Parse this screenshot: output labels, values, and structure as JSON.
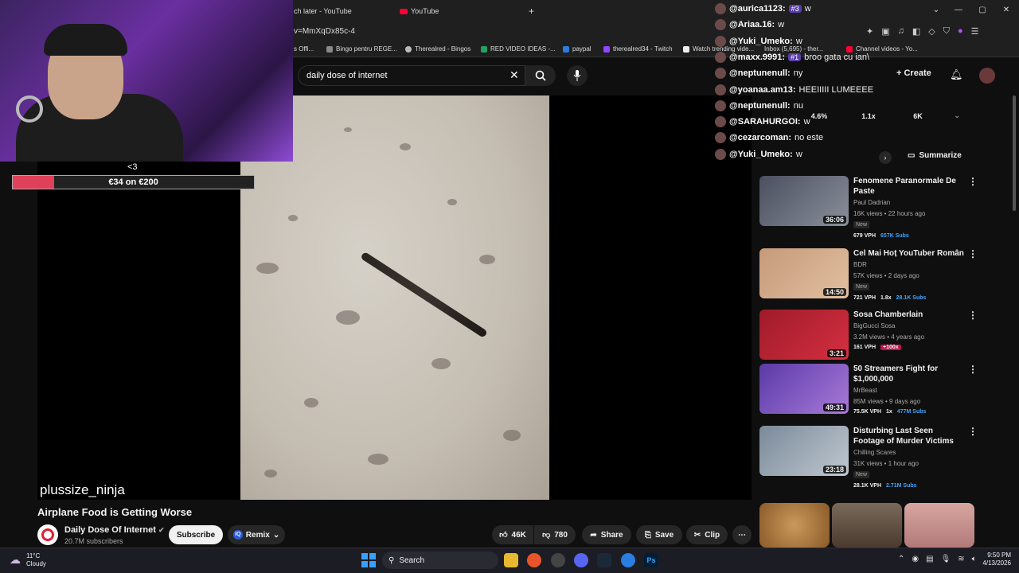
{
  "browser": {
    "tabs": [
      {
        "label": "ch later - YouTube"
      },
      {
        "label": "YouTube"
      }
    ],
    "new_tab": "+",
    "url": "v=MmXqDx85c-4",
    "bookmarks": [
      "s Offi...",
      "Bingo pentru REGE...",
      "Therealred - Bingos",
      "RED VIDEO IDEAS -...",
      "paypal",
      "therealred34 - Twitch",
      "Watch trending vide...",
      "Inbox (5,695) - ther...",
      "Channel videos - Yo..."
    ]
  },
  "youtube": {
    "search_value": "daily dose of internet",
    "create_label": "Create",
    "video_title": "Airplane Food is Getting Worse",
    "channel_name": "Daily Dose Of Internet",
    "channel_subs": "20.7M subscribers",
    "subscribe_label": "Subscribe",
    "remix_label": "Remix",
    "likes": "46K",
    "dislikes": "780",
    "share_label": "Share",
    "save_label": "Save",
    "clip_label": "Clip",
    "more_label": "⋯",
    "overlay_stats": [
      "4.6%",
      "1.1x",
      "6K"
    ],
    "summarize_label": "Summarize",
    "recommendations": [
      {
        "title": "Fenomene Paranormale De Paste",
        "channel": "Paul Dadrian",
        "meta": "16K views • 22 hours ago",
        "new": "New",
        "duration": "36:06",
        "vph": "679 VPH",
        "extra": "",
        "subs": "657K Subs"
      },
      {
        "title": "Cel Mai Hoț YouTuber Român",
        "channel": "BDR",
        "meta": "57K views • 2 days ago",
        "new": "New",
        "duration": "14:50",
        "vph": "721 VPH",
        "extra": "1.8x",
        "subs": "28.1K Subs"
      },
      {
        "title": "Sosa Chamberlain",
        "channel": "BigGucci Sosa",
        "meta": "3.2M views • 4 years ago",
        "new": "",
        "duration": "3:21",
        "vph": "161 VPH",
        "extra": "+100x",
        "subs": ""
      },
      {
        "title": "50 Streamers Fight for $1,000,000",
        "channel": "MrBeast",
        "meta": "85M views • 9 days ago",
        "new": "",
        "duration": "49:31",
        "vph": "75.5K VPH",
        "extra": "1x",
        "subs": "477M Subs"
      },
      {
        "title": "Disturbing Last Seen Footage of Murder Victims",
        "channel": "Chilling Scares",
        "meta": "31K views • 1 hour ago",
        "new": "New",
        "duration": "23:18",
        "vph": "28.1K VPH",
        "extra": "",
        "subs": "2.71M Subs"
      }
    ]
  },
  "stream": {
    "heart": "<3",
    "goal_text": "€34 on €200",
    "goal_progress": 0.17,
    "overlay_username": "plussize_ninja",
    "chat": [
      {
        "user": "@aurica1123:",
        "badge": "#3",
        "msg": "w"
      },
      {
        "user": "@Ariaa.16:",
        "badge": "",
        "msg": "w"
      },
      {
        "user": "@Yuki_Umeko:",
        "badge": "",
        "msg": "w"
      },
      {
        "user": "@maxx.9991:",
        "badge": "#1",
        "msg": "broo gata cu ian\\"
      },
      {
        "user": "@neptunenull:",
        "badge": "",
        "msg": "ny"
      },
      {
        "user": "@yoanaa.am13:",
        "badge": "",
        "msg": "HEEIIIII LUMEEEE"
      },
      {
        "user": "@neptunenull:",
        "badge": "",
        "msg": "nu"
      },
      {
        "user": "@SARAHURGOI:",
        "badge": "",
        "msg": "w"
      },
      {
        "user": "@cezarcoman:",
        "badge": "",
        "msg": "no este"
      },
      {
        "user": "@Yuki_Umeko:",
        "badge": "",
        "msg": "w"
      }
    ]
  },
  "taskbar": {
    "weather_temp": "11°C",
    "weather_desc": "Cloudy",
    "search_label": "Search",
    "time": "9:50 PM",
    "date": "4/13/2026"
  },
  "colors": {
    "youtube_red": "#ff0033",
    "goal_fill": "#e0405a",
    "chat_badge": "#5b3ea8",
    "subs_blue": "#3ea6ff"
  }
}
